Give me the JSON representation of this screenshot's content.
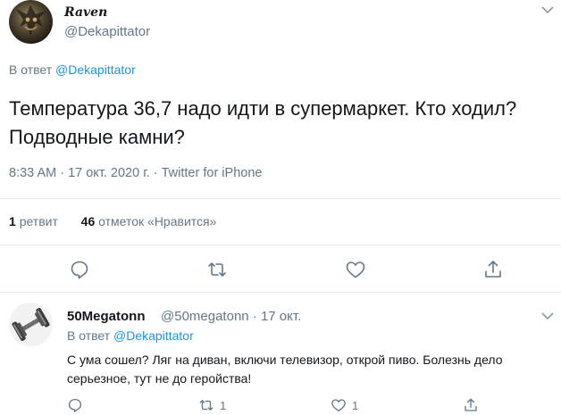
{
  "main_tweet": {
    "display_name": "Raven",
    "handle": "@Dekapittator",
    "reply_prefix": "В ответ",
    "reply_handle": "@Dekapittator",
    "text": "Температура 36,7 надо идти в супермаркет. Кто ходил? Подводные камни?",
    "meta": "8:33 AM · 17 окт. 2020 г. · Twitter for iPhone",
    "retweet_count": "1",
    "retweet_label": "ретвит",
    "like_count": "46",
    "like_label": "отметок «Нравится»"
  },
  "reply_tweet": {
    "display_name": "50Megatonn",
    "handle_and_date": "@50megatonn · 17 окт.",
    "reply_prefix": "В ответ",
    "reply_handle": "@Dekapittator",
    "text": "С ума сошел? Ляг на диван, включи телевизор, открой пиво. Болезнь дело серьезное, тут не до геройства!",
    "retweet_count": "1",
    "like_count": "1"
  },
  "icons": [
    "chevron-down-icon",
    "reply-icon",
    "retweet-icon",
    "like-icon",
    "share-icon"
  ],
  "colors": {
    "link": "#1b95e0",
    "secondary": "#657786",
    "divider": "#e6ecf0",
    "text": "#14171a"
  }
}
